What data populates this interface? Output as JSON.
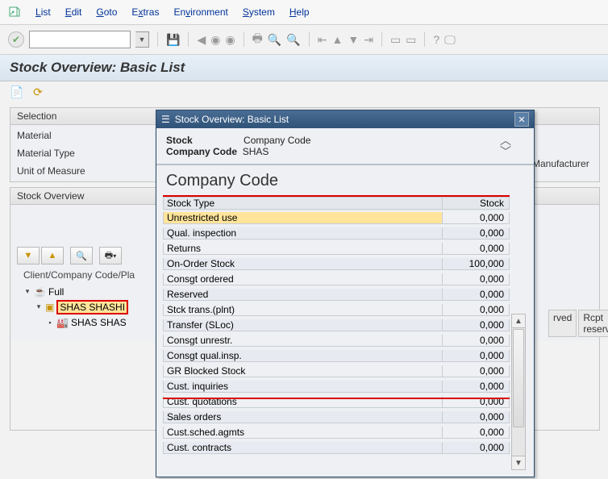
{
  "menu": {
    "list": "List",
    "edit": "Edit",
    "goto": "Goto",
    "extras": "Extras",
    "env": "Environment",
    "system": "System",
    "help": "Help"
  },
  "page_title": "Stock Overview: Basic List",
  "selection": {
    "panel_label": "Selection",
    "material": "Material",
    "material_type": "Material Type",
    "uom": "Unit of Measure",
    "manufacturer": "Manufacturer"
  },
  "stock_overview": {
    "panel_label": "Stock Overview",
    "cols_label": "Client/Company Code/Pla",
    "tree_full": "Full",
    "tree_shas": "SHAS SHASHI",
    "tree_shas2": "SHAS SHAS",
    "grid_cols": {
      "rved": "rved",
      "rcpt": "Rcpt reserva"
    }
  },
  "dialog": {
    "title": "Stock Overview: Basic List",
    "stock_lbl": "Stock",
    "cc_lbl": "Company Code",
    "cc_val": "Company Code",
    "cc_code": "SHAS",
    "section": "Company Code",
    "hdr_type": "Stock Type",
    "hdr_stock": "Stock",
    "rows": [
      {
        "l": "Unrestricted use",
        "r": "0,000"
      },
      {
        "l": "Qual. inspection",
        "r": "0,000"
      },
      {
        "l": "Returns",
        "r": "0,000"
      },
      {
        "l": "On-Order Stock",
        "r": "100,000"
      },
      {
        "l": "Consgt ordered",
        "r": "0,000"
      },
      {
        "l": "Reserved",
        "r": "0,000"
      },
      {
        "l": "Stck trans.(plnt)",
        "r": "0,000"
      },
      {
        "l": "Transfer (SLoc)",
        "r": "0,000"
      },
      {
        "l": "Consgt unrestr.",
        "r": "0,000"
      },
      {
        "l": "Consgt qual.insp.",
        "r": "0,000"
      },
      {
        "l": "GR Blocked Stock",
        "r": "0,000"
      },
      {
        "l": "Cust. inquiries",
        "r": "0,000"
      },
      {
        "l": "Cust. quotations",
        "r": "0,000"
      },
      {
        "l": "Sales orders",
        "r": "0,000"
      },
      {
        "l": "Cust.sched.agmts",
        "r": "0,000"
      },
      {
        "l": "Cust. contracts",
        "r": "0,000"
      }
    ]
  }
}
